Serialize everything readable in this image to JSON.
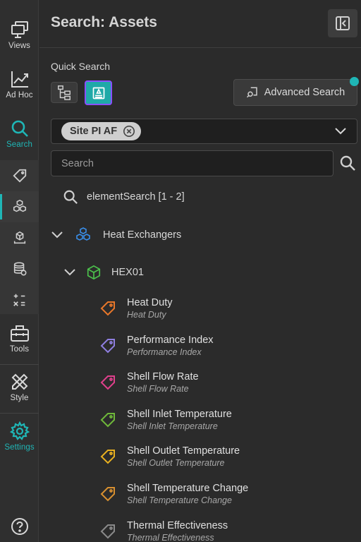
{
  "rail": {
    "items": [
      {
        "label": "Views",
        "icon": "monitor-icon"
      },
      {
        "label": "Ad Hoc",
        "icon": "trend-chart-icon"
      },
      {
        "label": "Search",
        "icon": "search-icon"
      },
      {
        "label": "Tools",
        "icon": "toolbox-icon"
      },
      {
        "label": "Style",
        "icon": "pencil-ruler-icon"
      },
      {
        "label": "Settings",
        "icon": "gear-icon"
      }
    ],
    "accent": "#1fb6b6"
  },
  "header": {
    "title": "Search: Assets"
  },
  "quick_search": {
    "label": "Quick Search",
    "advanced_label": "Advanced Search"
  },
  "server": {
    "chip": "Site PI AF"
  },
  "search": {
    "placeholder": "Search"
  },
  "tree": {
    "query": "elementSearch [1 - 2]",
    "group": "Heat Exchangers",
    "element": "HEX01",
    "attributes": [
      {
        "name": "Heat Duty",
        "description": "Heat Duty",
        "color": "#e8772a"
      },
      {
        "name": "Performance Index",
        "description": "Performance Index",
        "color": "#8f7fe0"
      },
      {
        "name": "Shell Flow Rate",
        "description": "Shell Flow Rate",
        "color": "#e0408c"
      },
      {
        "name": "Shell Inlet Temperature",
        "description": "Shell Inlet Temperature",
        "color": "#6fb83a"
      },
      {
        "name": "Shell Outlet Temperature",
        "description": "Shell Outlet Temperature",
        "color": "#e8b020"
      },
      {
        "name": "Shell Temperature Change",
        "description": "Shell Temperature Change",
        "color": "#d89030"
      },
      {
        "name": "Thermal Effectiveness",
        "description": "Thermal Effectiveness",
        "color": "#8a8a8a"
      }
    ]
  }
}
